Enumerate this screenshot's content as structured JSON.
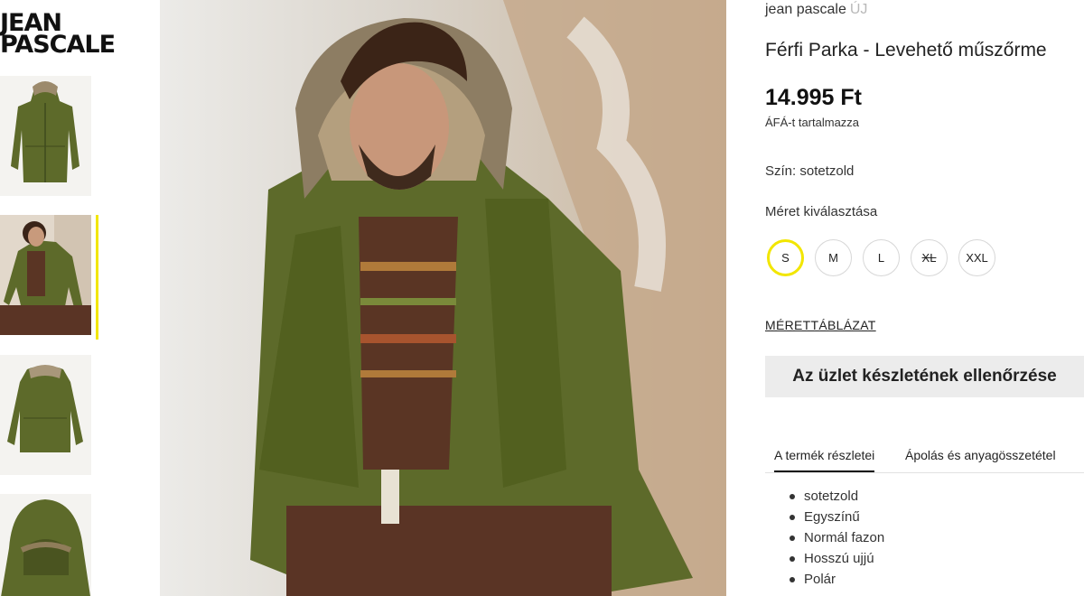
{
  "logo": {
    "line1": "JEAN",
    "line2": "PASCALE"
  },
  "gallery": {
    "thumbnails": [
      {
        "alt": "parka-front-thumbnail"
      },
      {
        "alt": "model-thumbnail",
        "active": true
      },
      {
        "alt": "parka-back-thumbnail"
      },
      {
        "alt": "parka-hood-detail-thumbnail"
      }
    ],
    "active_color": "#f2e600"
  },
  "product": {
    "brand": "jean pascale",
    "badge": "ÚJ",
    "title": "Férfi Parka - Levehető műszőrme",
    "price": "14.995 Ft",
    "vat_note": "ÁFÁ-t tartalmazza",
    "color_label": "Szín: sotetzold",
    "size_label": "Méret kiválasztása",
    "sizes": [
      {
        "label": "S",
        "selected": true,
        "available": true
      },
      {
        "label": "M",
        "selected": false,
        "available": true
      },
      {
        "label": "L",
        "selected": false,
        "available": true
      },
      {
        "label": "XL",
        "selected": false,
        "available": false
      },
      {
        "label": "XXL",
        "selected": false,
        "available": true
      }
    ],
    "size_chart_link": "MÉRETTÁBLÁZAT",
    "stock_button": "Az üzlet készletének ellenőrzése"
  },
  "tabs": [
    {
      "label": "A termék részletei",
      "active": true
    },
    {
      "label": "Ápolás és anyagösszetétel",
      "active": false
    }
  ],
  "features": [
    "sotetzold",
    "Egyszínű",
    "Normál fazon",
    "Hosszú ujjú",
    "Polár"
  ],
  "colors": {
    "accent": "#f2e600",
    "parka": "#5d6a2a",
    "button_bg": "#ececec"
  }
}
